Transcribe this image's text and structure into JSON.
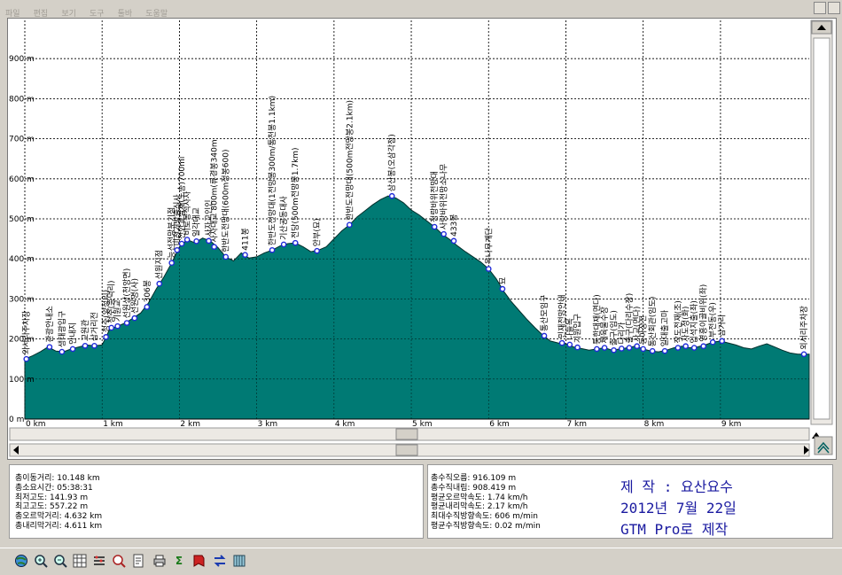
{
  "menu": [
    "파일",
    "편집",
    "보기",
    "도구",
    "툴바",
    "도움말"
  ],
  "chart_data": {
    "type": "area",
    "x_unit": "km",
    "xlim": [
      0,
      10.148
    ],
    "ylim": [
      0,
      1000
    ],
    "x_ticks": [
      {
        "v": 0,
        "label": "0 km"
      },
      {
        "v": 1,
        "label": "1 km"
      },
      {
        "v": 2,
        "label": "2 km"
      },
      {
        "v": 3,
        "label": "3 km"
      },
      {
        "v": 4,
        "label": "4 km"
      },
      {
        "v": 5,
        "label": "5 km"
      },
      {
        "v": 6,
        "label": "6 km"
      },
      {
        "v": 7,
        "label": "7 km"
      },
      {
        "v": 8,
        "label": "8 km"
      },
      {
        "v": 9,
        "label": "9 km"
      }
    ],
    "y_ticks": [
      {
        "v": 0,
        "label": "0 m"
      },
      {
        "v": 100,
        "label": "100 m"
      },
      {
        "v": 200,
        "label": "200 m"
      },
      {
        "v": 300,
        "label": "300 m"
      },
      {
        "v": 400,
        "label": "400 m"
      },
      {
        "v": 500,
        "label": "500 m"
      },
      {
        "v": 600,
        "label": "600 m"
      },
      {
        "v": 700,
        "label": "700 m"
      },
      {
        "v": 800,
        "label": "800 m"
      },
      {
        "v": 900,
        "label": "900 m"
      }
    ],
    "grid": true,
    "fill_color": "#007a74",
    "line_color": "#002e2b",
    "marker_color": "#1f2ad8",
    "profile": [
      [
        0,
        150
      ],
      [
        0.1,
        158
      ],
      [
        0.2,
        168
      ],
      [
        0.3,
        180
      ],
      [
        0.4,
        170
      ],
      [
        0.5,
        168
      ],
      [
        0.6,
        175
      ],
      [
        0.7,
        180
      ],
      [
        0.8,
        185
      ],
      [
        0.9,
        183
      ],
      [
        1.0,
        185
      ],
      [
        1.05,
        205
      ],
      [
        1.1,
        225
      ],
      [
        1.2,
        232
      ],
      [
        1.3,
        240
      ],
      [
        1.4,
        252
      ],
      [
        1.5,
        265
      ],
      [
        1.6,
        290
      ],
      [
        1.7,
        325
      ],
      [
        1.8,
        355
      ],
      [
        1.9,
        390
      ],
      [
        2.0,
        430
      ],
      [
        2.1,
        448
      ],
      [
        2.2,
        440
      ],
      [
        2.3,
        452
      ],
      [
        2.4,
        445
      ],
      [
        2.5,
        428
      ],
      [
        2.6,
        405
      ],
      [
        2.7,
        395
      ],
      [
        2.8,
        415
      ],
      [
        2.9,
        402
      ],
      [
        3.0,
        405
      ],
      [
        3.1,
        415
      ],
      [
        3.2,
        422
      ],
      [
        3.3,
        432
      ],
      [
        3.4,
        438
      ],
      [
        3.5,
        440
      ],
      [
        3.6,
        430
      ],
      [
        3.7,
        418
      ],
      [
        3.8,
        422
      ],
      [
        3.9,
        430
      ],
      [
        4.0,
        450
      ],
      [
        4.1,
        470
      ],
      [
        4.2,
        485
      ],
      [
        4.3,
        505
      ],
      [
        4.4,
        520
      ],
      [
        4.5,
        535
      ],
      [
        4.6,
        548
      ],
      [
        4.7,
        557
      ],
      [
        4.8,
        552
      ],
      [
        4.9,
        540
      ],
      [
        5.0,
        522
      ],
      [
        5.1,
        510
      ],
      [
        5.2,
        495
      ],
      [
        5.3,
        480
      ],
      [
        5.4,
        462
      ],
      [
        5.5,
        448
      ],
      [
        5.6,
        432
      ],
      [
        5.7,
        418
      ],
      [
        5.8,
        405
      ],
      [
        5.9,
        392
      ],
      [
        6.0,
        375
      ],
      [
        6.1,
        350
      ],
      [
        6.2,
        318
      ],
      [
        6.3,
        292
      ],
      [
        6.4,
        270
      ],
      [
        6.5,
        248
      ],
      [
        6.6,
        228
      ],
      [
        6.7,
        210
      ],
      [
        6.8,
        195
      ],
      [
        6.9,
        190
      ],
      [
        7.0,
        188
      ],
      [
        7.1,
        180
      ],
      [
        7.2,
        176
      ],
      [
        7.3,
        172
      ],
      [
        7.4,
        175
      ],
      [
        7.5,
        178
      ],
      [
        7.6,
        172
      ],
      [
        7.7,
        175
      ],
      [
        7.8,
        178
      ],
      [
        7.9,
        182
      ],
      [
        8.0,
        175
      ],
      [
        8.1,
        170
      ],
      [
        8.2,
        168
      ],
      [
        8.3,
        172
      ],
      [
        8.4,
        178
      ],
      [
        8.5,
        182
      ],
      [
        8.6,
        178
      ],
      [
        8.7,
        180
      ],
      [
        8.8,
        185
      ],
      [
        8.9,
        192
      ],
      [
        9.0,
        195
      ],
      [
        9.1,
        190
      ],
      [
        9.2,
        185
      ],
      [
        9.3,
        178
      ],
      [
        9.4,
        175
      ],
      [
        9.5,
        182
      ],
      [
        9.6,
        188
      ],
      [
        9.7,
        180
      ],
      [
        9.8,
        172
      ],
      [
        9.9,
        165
      ],
      [
        10.0,
        162
      ],
      [
        10.148,
        162
      ]
    ],
    "waypoints": [
      {
        "x": 0.02,
        "y": 150,
        "label": "외서리주차장"
      },
      {
        "x": 0.32,
        "y": 180,
        "label": "관광안내소"
      },
      {
        "x": 0.48,
        "y": 168,
        "label": "생태광입구"
      },
      {
        "x": 0.62,
        "y": 175,
        "label": "안내지"
      },
      {
        "x": 0.78,
        "y": 183,
        "label": "교원관"
      },
      {
        "x": 0.9,
        "y": 183,
        "label": "삼거리전"
      },
      {
        "x": 1.05,
        "y": 205,
        "label": "청주(양정리)"
      },
      {
        "x": 1.12,
        "y": 228,
        "label": "청주(응덕리)"
      },
      {
        "x": 1.2,
        "y": 232,
        "label": "기원교"
      },
      {
        "x": 1.32,
        "y": 240,
        "label": "선원상(천앙면)"
      },
      {
        "x": 1.42,
        "y": 252,
        "label": "선원명(사)"
      },
      {
        "x": 1.58,
        "y": 280,
        "label": "306봉"
      },
      {
        "x": 1.74,
        "y": 338,
        "label": "선원지점"
      },
      {
        "x": 1.9,
        "y": 390,
        "label": "능선전망분기점"
      },
      {
        "x": 1.97,
        "y": 422,
        "label": "미천거방출신사"
      },
      {
        "x": 2.03,
        "y": 438,
        "label": "전한교실재(노송)700mi"
      },
      {
        "x": 2.1,
        "y": 448,
        "label": "비로봉적사자"
      },
      {
        "x": 2.22,
        "y": 444,
        "label": "일각대교"
      },
      {
        "x": 2.38,
        "y": 445,
        "label": "사자교인인"
      },
      {
        "x": 2.45,
        "y": 430,
        "label": "사자대교 800m(류경봉340m"
      },
      {
        "x": 2.6,
        "y": 405,
        "label": "한반도전망대(600m정봉600)"
      },
      {
        "x": 2.85,
        "y": 410,
        "label": "411봉"
      },
      {
        "x": 3.2,
        "y": 422,
        "label": "한반도전망대(1전망봉300m/통천봉1.1km)"
      },
      {
        "x": 3.35,
        "y": 436,
        "label": "기산공동대사"
      },
      {
        "x": 3.5,
        "y": 440,
        "label": "전당(500m전망봉1.7km)"
      },
      {
        "x": 3.78,
        "y": 420,
        "label": "안부(묘)"
      },
      {
        "x": 4.2,
        "y": 485,
        "label": "한반도전망대(500m전망봉2.1km)"
      },
      {
        "x": 4.75,
        "y": 557,
        "label": "삼산봉(오삼각점)"
      },
      {
        "x": 5.3,
        "y": 480,
        "label": "청랑바위전망대"
      },
      {
        "x": 5.42,
        "y": 462,
        "label": "사랑바위전망소나무"
      },
      {
        "x": 5.55,
        "y": 445,
        "label": "433봉"
      },
      {
        "x": 6.0,
        "y": 375,
        "label": "옥나무계단"
      },
      {
        "x": 6.18,
        "y": 325,
        "label": "묘"
      },
      {
        "x": 6.72,
        "y": 208,
        "label": "통산모임구"
      },
      {
        "x": 6.95,
        "y": 190,
        "label": "민재전망안내"
      },
      {
        "x": 7.05,
        "y": 186,
        "label": "나들목"
      },
      {
        "x": 7.15,
        "y": 179,
        "label": "기원입구"
      },
      {
        "x": 7.4,
        "y": 175,
        "label": "통한대재(면다)"
      },
      {
        "x": 7.5,
        "y": 178,
        "label": "체육물수장"
      },
      {
        "x": 7.62,
        "y": 172,
        "label": "출구(임도)"
      },
      {
        "x": 7.72,
        "y": 176,
        "label": "다리가"
      },
      {
        "x": 7.82,
        "y": 178,
        "label": "출구(다리수장)"
      },
      {
        "x": 7.92,
        "y": 182,
        "label": "사교(면다)"
      },
      {
        "x": 8.0,
        "y": 175,
        "label": "동아장전"
      },
      {
        "x": 8.12,
        "y": 170,
        "label": "통산회관(임도)"
      },
      {
        "x": 8.28,
        "y": 170,
        "label": "일대출고마"
      },
      {
        "x": 8.45,
        "y": 178,
        "label": "작도전재(조)"
      },
      {
        "x": 8.55,
        "y": 182,
        "label": "자도정(화)"
      },
      {
        "x": 8.66,
        "y": 178,
        "label": "입석지출(좌)"
      },
      {
        "x": 8.78,
        "y": 182,
        "label": "영흥이골비위(좌)"
      },
      {
        "x": 8.9,
        "y": 192,
        "label": "부전동(우)"
      },
      {
        "x": 9.02,
        "y": 195,
        "label": "삼거리"
      },
      {
        "x": 10.08,
        "y": 162,
        "label": "외서리주차장"
      }
    ]
  },
  "stats_left": [
    "총이동거리: 10.148 km",
    "총소요시간: 05:38:31",
    "최저고도: 141.93 m",
    "최고고도: 557.22 m",
    "총오르막거리: 4.632 km",
    "총내리막거리: 4.611 km"
  ],
  "stats_right": [
    "총수직오름: 916.109 m",
    "총수직내림: 908.419 m",
    "평균오르막속도: 1.74 km/h",
    "평균내리막속도: 2.17 km/h",
    "최대수직방향속도: 606 m/min",
    "평균수직방향속도: 0.02 m/min"
  ],
  "credit": {
    "line1": "제 작 : 요산요수",
    "line2": "2012년 7월 22일",
    "line3": "GTM Pro로 제작"
  },
  "toolbar_icons": [
    "globe-icon",
    "zoom-in-icon",
    "zoom-out-icon",
    "grid-icon",
    "settings-icon",
    "find-icon",
    "document-icon",
    "print-icon",
    "sum-icon",
    "bookmark-icon",
    "swap-icon",
    "export-icon"
  ]
}
